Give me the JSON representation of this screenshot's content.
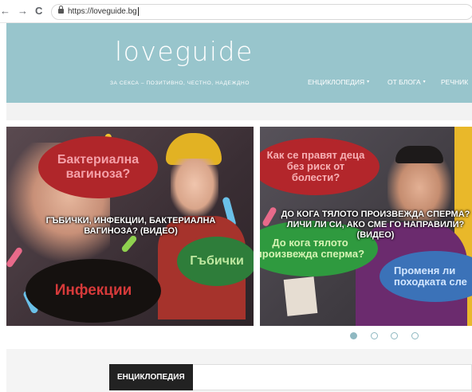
{
  "browser": {
    "url": "https://loveguide.bg",
    "back_glyph": "←",
    "forward_glyph": "→",
    "reload_glyph": "C"
  },
  "header": {
    "logo": "loveguide",
    "tagline": "ЗА СЕКСА – ПОЗИТИВНО, ЧЕСТНО, НАДЕЖДНО",
    "nav": [
      {
        "label": "ЕНЦИКЛОПЕДИЯ",
        "has_dropdown": true
      },
      {
        "label": "ОТ БЛОГА",
        "has_dropdown": true
      },
      {
        "label": "РЕЧНИК",
        "has_dropdown": false
      }
    ],
    "dropdown_glyph": "▾",
    "background_color": "#98c5cc"
  },
  "slides": [
    {
      "bubbles": [
        "Бактериална вагиноза?",
        "Гъбички",
        "Инфекции"
      ],
      "caption": "ГЪБИЧКИ, ИНФЕКЦИИ, БАКТЕРИАЛНА ВАГИНОЗА? (ВИДЕО)"
    },
    {
      "bubbles": [
        "Как се правят деца без риск от болести?",
        "До кога тялото произвежда сперма?",
        "Променя ли походката сле"
      ],
      "caption": "ДО КОГА ТЯЛОТО ПРОИЗВЕЖДА СПЕРМА? ЛИЧИ ЛИ СИ, АКО СМЕ ГО НАПРАВИЛИ? (ВИДЕО)"
    }
  ],
  "slider_dots": {
    "count": 4,
    "active_index": 0
  },
  "section": {
    "label": "ЕНЦИКЛОПЕДИЯ"
  }
}
